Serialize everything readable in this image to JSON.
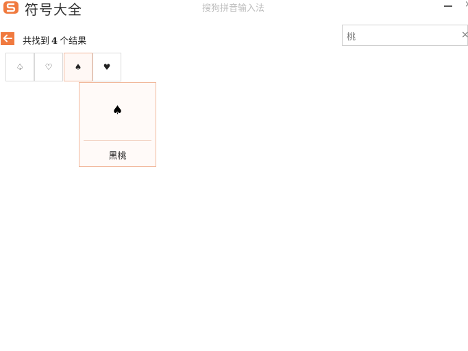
{
  "window": {
    "app_title": "符号大全",
    "ime_title": "搜狗拼音输入法",
    "close_label": "×"
  },
  "colors": {
    "brand": "#f07a3f",
    "highlight_border": "#f1b79a"
  },
  "icons": {
    "logo": "sogou-logo-icon",
    "back": "back-arrow-icon",
    "minimize": "minimize-icon",
    "close": "close-icon",
    "clear": "clear-icon"
  },
  "results": {
    "prefix": "共找到",
    "count": "4",
    "suffix": "个结果"
  },
  "search": {
    "value": "桃",
    "clear_label": "×"
  },
  "symbols": [
    {
      "char": "♤",
      "name": ""
    },
    {
      "char": "♡",
      "name": ""
    },
    {
      "char": "♠",
      "name": "黑桃"
    },
    {
      "char": "♥",
      "name": ""
    }
  ],
  "selected": {
    "char": "♠",
    "name": "黑桃"
  }
}
